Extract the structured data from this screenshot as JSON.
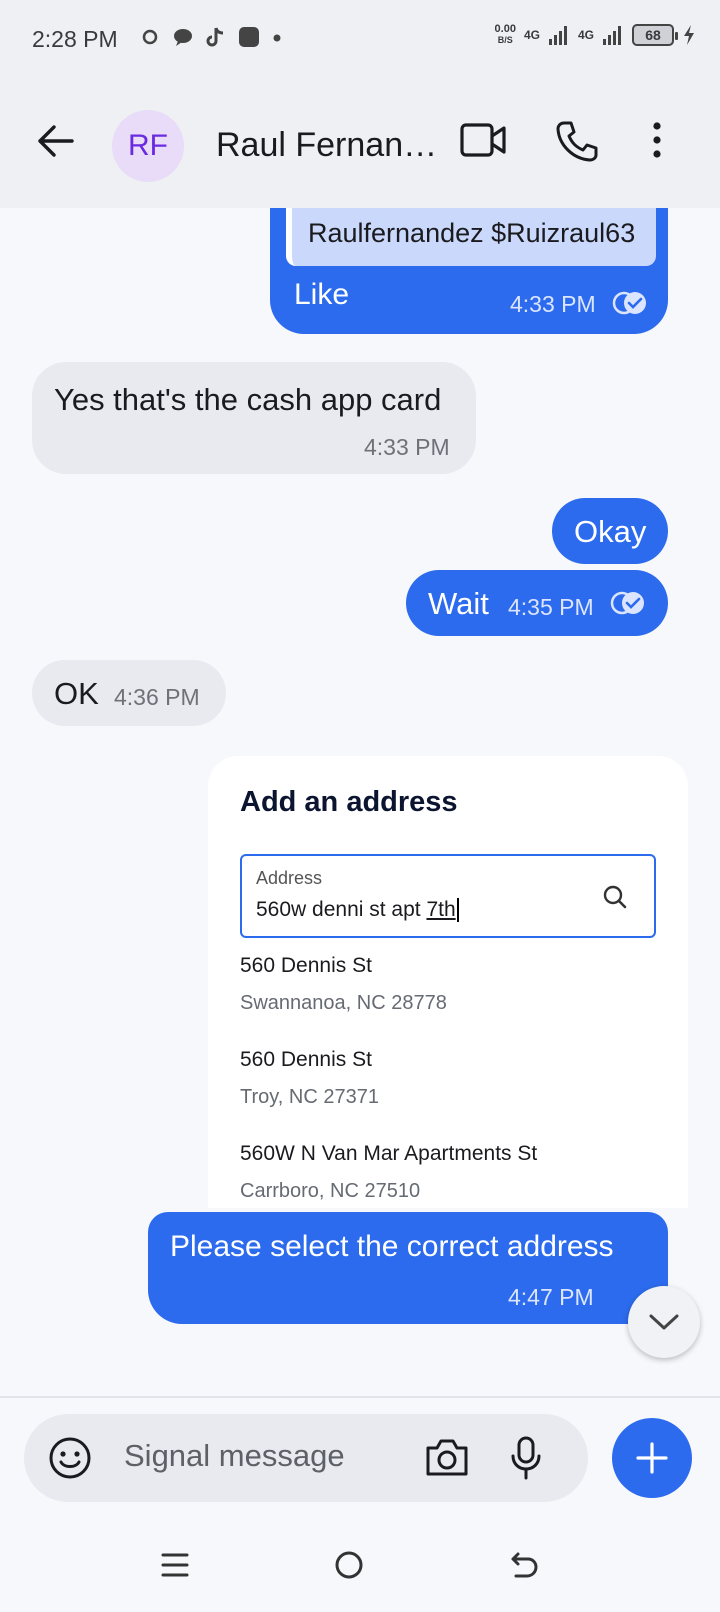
{
  "status_bar": {
    "time": "2:28 PM",
    "net_speed_top": "0.00",
    "net_speed_bottom": "B/S",
    "network1": "4G",
    "network2": "4G",
    "battery": "68"
  },
  "header": {
    "avatar_initials": "RF",
    "contact_name": "Raul Fernandez"
  },
  "messages": [
    {
      "dir": "out",
      "quote": "Raulfernandez $Ruizraul63",
      "text": "Like",
      "time": "4:33 PM"
    },
    {
      "dir": "in",
      "text": "Yes that's the cash app card",
      "time": "4:33 PM"
    },
    {
      "dir": "out",
      "text": "Okay"
    },
    {
      "dir": "out",
      "text": "Wait",
      "time": "4:35 PM"
    },
    {
      "dir": "in",
      "text": "OK",
      "time": "4:36 PM"
    },
    {
      "dir": "out",
      "text": "Please select the correct address",
      "time": "4:47 PM"
    }
  ],
  "attachment": {
    "title": "Add an address",
    "field_label": "Address",
    "field_value_prefix": "560w denni st apt ",
    "field_value_underlined": "7th",
    "suggestions": [
      {
        "line1": "560 Dennis St",
        "line2": "Swannanoa, NC 28778"
      },
      {
        "line1": "560 Dennis St",
        "line2": "Troy, NC 27371"
      },
      {
        "line1": "560W N Van Mar Apartments St",
        "line2": "Carrboro, NC 27510"
      }
    ]
  },
  "compose": {
    "placeholder": "Signal message"
  },
  "colors": {
    "outgoing_bubble": "#2c6bed",
    "incoming_bubble": "#e8eaf0",
    "avatar_bg": "#e8dcf8",
    "avatar_text": "#6a2be0"
  }
}
